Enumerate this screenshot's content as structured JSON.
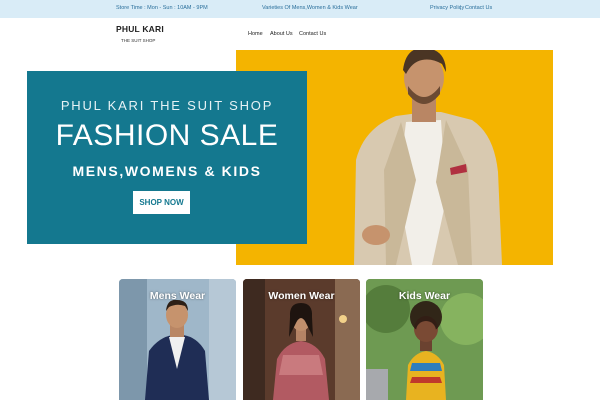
{
  "topbar": {
    "store_hours": "Store Time : Mon - Sun : 10AM - 9PM",
    "varieties": "Varieties Of Mens,Women & Kids Wear",
    "privacy_label": "Privacy Policy",
    "separator": "|",
    "contact_label": "Contact Us"
  },
  "header": {
    "brand": "PHUL KARI",
    "tagline": "THE SUIT SHOP",
    "nav": [
      {
        "label": "Home"
      },
      {
        "label": "About Us"
      },
      {
        "label": "Contact Us"
      }
    ]
  },
  "hero": {
    "kicker": "PHUL KARI THE SUIT SHOP",
    "title": "FASHION SALE",
    "subtitle": "MENS,WOMENS & KIDS",
    "cta_label": "SHOP NOW",
    "panel_color": "#14788f",
    "photo_background": "#f4b400"
  },
  "categories": [
    {
      "title": "Mens Wear"
    },
    {
      "title": "Women Wear"
    },
    {
      "title": "Kids Wear"
    }
  ]
}
